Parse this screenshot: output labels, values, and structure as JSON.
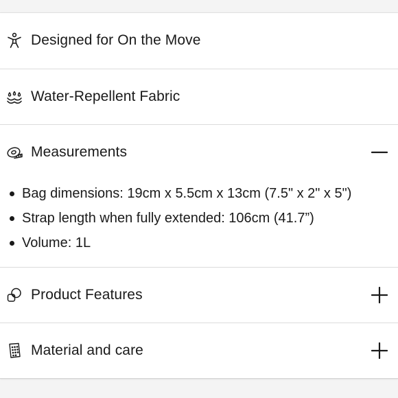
{
  "accordion": {
    "items": [
      {
        "label": "Designed for On the Move",
        "icon": "person-stretch-icon",
        "expanded": false,
        "has_toggle": false
      },
      {
        "label": "Water-Repellent Fabric",
        "icon": "water-drops-icon",
        "expanded": false,
        "has_toggle": false
      },
      {
        "label": "Measurements",
        "icon": "measuring-tape-icon",
        "expanded": true,
        "has_toggle": true
      },
      {
        "label": "Product Features",
        "icon": "overlapping-shapes-icon",
        "expanded": false,
        "has_toggle": true
      },
      {
        "label": "Material and care",
        "icon": "fabric-swatch-icon",
        "expanded": false,
        "has_toggle": true
      }
    ],
    "measurements_details": [
      "Bag dimensions: 19cm x 5.5cm x 13cm (7.5\" x 2\" x 5\")",
      "Strap length when fully extended: 106cm (41.7”)",
      "Volume: 1L"
    ]
  },
  "colors": {
    "page_background": "#f4f4f4",
    "panel_background": "#ffffff",
    "text": "#1a1a1a",
    "divider": "#dcdcdc"
  }
}
